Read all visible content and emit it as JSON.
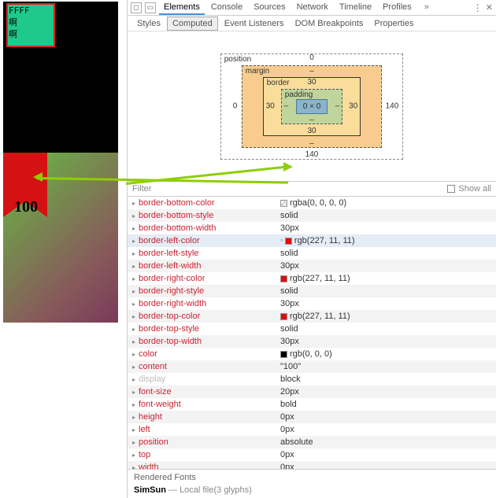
{
  "left": {
    "green_text": [
      "FFFF",
      "啊",
      "啊"
    ],
    "badge": "100"
  },
  "toolbar_tabs": [
    "Elements",
    "Console",
    "Sources",
    "Network",
    "Timeline",
    "Profiles"
  ],
  "toolbar_more": "»",
  "subtabs": [
    "Styles",
    "Computed",
    "Event Listeners",
    "DOM Breakpoints",
    "Properties"
  ],
  "boxmodel": {
    "position": {
      "label": "position",
      "t": "0",
      "r": "",
      "b": "",
      "l": ""
    },
    "margin": {
      "label": "margin",
      "t": "–",
      "r": "140",
      "b": "140",
      "l": "0"
    },
    "border": {
      "label": "border",
      "t": "30",
      "r": "30",
      "b": "30",
      "l": "30"
    },
    "padding": {
      "label": "padding",
      "t": "",
      "r": "–",
      "b": "–",
      "l": "–"
    },
    "content": "0 × 0"
  },
  "filter": {
    "label": "Filter",
    "showall": "Show all"
  },
  "props": [
    {
      "k": "border-bottom-color",
      "v": "rgba(0, 0, 0, 0)",
      "sw": "transparent"
    },
    {
      "k": "border-bottom-style",
      "v": "solid"
    },
    {
      "k": "border-bottom-width",
      "v": "30px"
    },
    {
      "k": "border-left-color",
      "v": "rgb(227, 11, 11)",
      "sw": "#e30b0b",
      "sel": true,
      "dot": true
    },
    {
      "k": "border-left-style",
      "v": "solid"
    },
    {
      "k": "border-left-width",
      "v": "30px"
    },
    {
      "k": "border-right-color",
      "v": "rgb(227, 11, 11)",
      "sw": "#e30b0b"
    },
    {
      "k": "border-right-style",
      "v": "solid"
    },
    {
      "k": "border-right-width",
      "v": "30px"
    },
    {
      "k": "border-top-color",
      "v": "rgb(227, 11, 11)",
      "sw": "#e30b0b"
    },
    {
      "k": "border-top-style",
      "v": "solid"
    },
    {
      "k": "border-top-width",
      "v": "30px"
    },
    {
      "k": "color",
      "v": "rgb(0, 0, 0)",
      "sw": "#000000"
    },
    {
      "k": "content",
      "v": "\"100\""
    },
    {
      "k": "display",
      "v": "block",
      "gray": true
    },
    {
      "k": "font-size",
      "v": "20px"
    },
    {
      "k": "font-weight",
      "v": "bold"
    },
    {
      "k": "height",
      "v": "0px"
    },
    {
      "k": "left",
      "v": "0px"
    },
    {
      "k": "position",
      "v": "absolute"
    },
    {
      "k": "top",
      "v": "0px"
    },
    {
      "k": "width",
      "v": "0px"
    }
  ],
  "rendered": {
    "h": "Rendered Fonts",
    "name": "SimSun",
    "detail": " — Local file(3 glyphs)"
  }
}
